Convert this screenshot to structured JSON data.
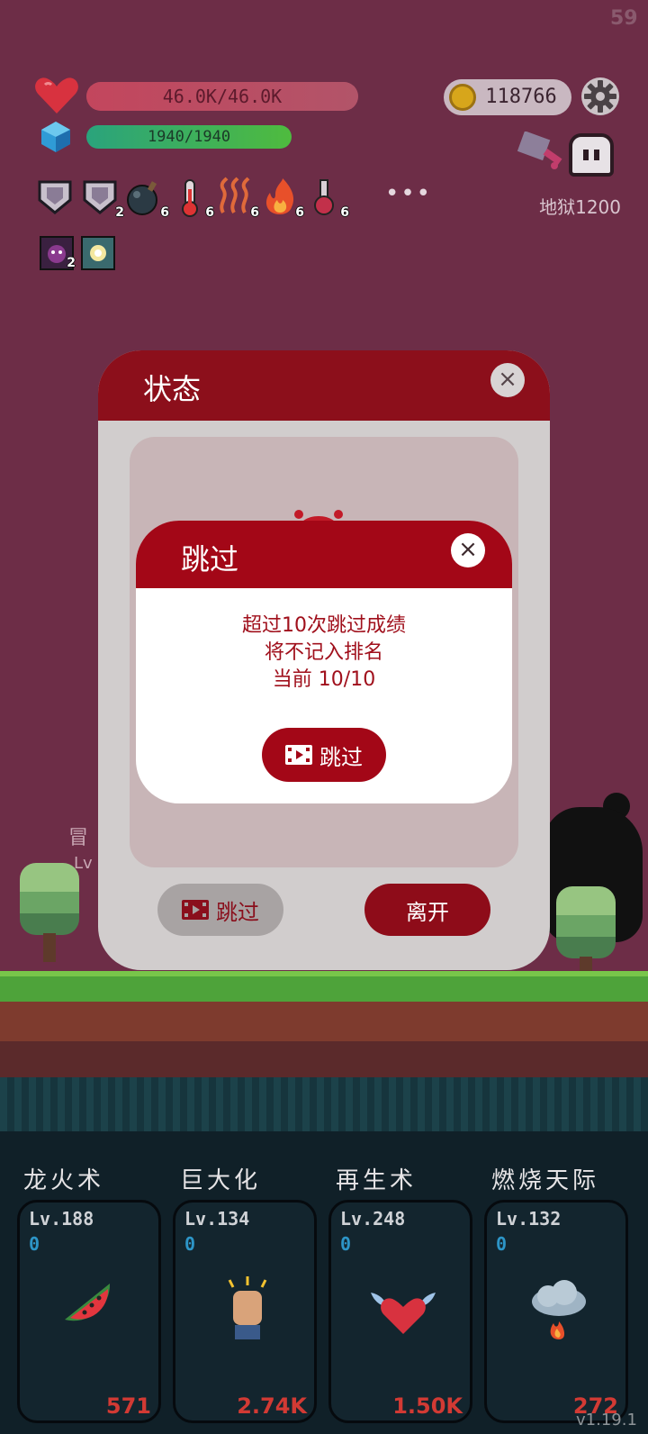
{
  "hud": {
    "fps": "59",
    "hp": {
      "text": "46.0K/46.0K",
      "fraction": 1.0
    },
    "mana": {
      "text": "1940/1940",
      "fraction": 1.0
    },
    "gold": "118766",
    "hell_level": "地狱1200",
    "more": "•••",
    "buffs": [
      {
        "icon": "shield-buff-icon",
        "count": ""
      },
      {
        "icon": "shield-buff-icon",
        "count": "2"
      },
      {
        "icon": "bomb-icon",
        "count": "6"
      },
      {
        "icon": "thermometer-icon",
        "count": "6"
      },
      {
        "icon": "heat-waves-icon",
        "count": "6"
      },
      {
        "icon": "fire-icon",
        "count": "6"
      },
      {
        "icon": "potion-icon",
        "count": "6"
      }
    ],
    "buffs2": [
      {
        "icon": "demon-icon",
        "count": "2"
      },
      {
        "icon": "light-icon",
        "count": ""
      }
    ]
  },
  "scene": {
    "adventurer_label": "冒",
    "adventurer_lv": "Lv"
  },
  "status_dialog": {
    "title": "状态",
    "skip_label": "跳过",
    "leave_label": "离开",
    "close": "×"
  },
  "skip_dialog": {
    "title": "跳过",
    "close": "×",
    "message_lines": [
      "超过10次跳过成绩",
      "将不记入排名",
      "当前 10/10"
    ],
    "action_label": "跳过"
  },
  "skills": [
    {
      "name": "龙火术",
      "level": "Lv.188",
      "extra": "0",
      "cost": "571",
      "icon": "watermelon-icon"
    },
    {
      "name": "巨大化",
      "level": "Lv.134",
      "extra": "0",
      "cost": "2.74K",
      "icon": "fist-icon"
    },
    {
      "name": "再生术",
      "level": "Lv.248",
      "extra": "0",
      "cost": "1.50K",
      "icon": "winged-heart-icon"
    },
    {
      "name": "燃烧天际",
      "level": "Lv.132",
      "extra": "0",
      "cost": "272",
      "icon": "fire-cloud-icon"
    }
  ],
  "version": "v1.19.1",
  "colors": {
    "background": "#6d2d47",
    "dialog_red": "#a30717",
    "status_red": "#8c0f1b",
    "panel": "#102028"
  }
}
